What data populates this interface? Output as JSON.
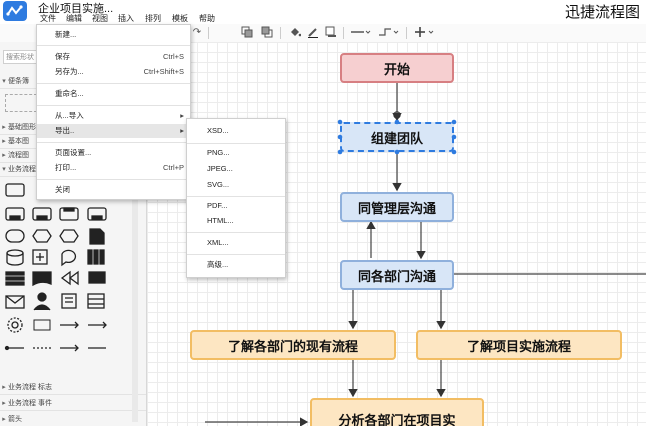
{
  "header": {
    "doc_title": "企业项目实施...",
    "brand": "迅捷流程图",
    "menus": [
      "文件",
      "编辑",
      "视图",
      "插入",
      "排列",
      "模板",
      "帮助"
    ]
  },
  "toolbar": {
    "icons": [
      "undo-icon",
      "redo-icon",
      "to-front-icon",
      "to-back-icon",
      "fill-color-icon",
      "line-color-icon",
      "shadow-icon",
      "line-style-icon",
      "waypoint-icon",
      "insert-icon"
    ]
  },
  "sidebar": {
    "search_placeholder": "搜索形状",
    "sections": [
      {
        "label": "便条簿",
        "expanded": true
      },
      {
        "label": "基础图形",
        "expanded": false
      },
      {
        "label": "基本图",
        "expanded": false
      },
      {
        "label": "流程图",
        "expanded": false
      },
      {
        "label": "业务流程",
        "expanded": true
      }
    ],
    "bottom_sections": [
      "业务流程 标志",
      "业务流程 事件",
      "箭头"
    ]
  },
  "file_menu": {
    "items": [
      {
        "label": "新建..."
      },
      {
        "label": "保存",
        "shortcut": "Ctrl+S"
      },
      {
        "label": "另存为...",
        "shortcut": "Ctrl+Shift+S"
      },
      {
        "label": "重命名..."
      },
      {
        "label": "从...导入",
        "submenu": true
      },
      {
        "label": "导出..",
        "submenu": true,
        "highlighted": true
      },
      {
        "label": "页面设置..."
      },
      {
        "label": "打印...",
        "shortcut": "Ctrl+P"
      },
      {
        "label": "关闭"
      }
    ]
  },
  "export_menu": {
    "items": [
      "XSD...",
      "PNG...",
      "JPEG...",
      "SVG...",
      "PDF...",
      "HTML...",
      "XML...",
      "高级..."
    ]
  },
  "diagram": {
    "nodes": [
      {
        "id": "start",
        "label": "开始",
        "style": "pink"
      },
      {
        "id": "team",
        "label": "组建团队",
        "style": "blue",
        "selected": true
      },
      {
        "id": "mgmt",
        "label": "同管理层沟通",
        "style": "blue"
      },
      {
        "id": "depts",
        "label": "同各部门沟通",
        "style": "blue"
      },
      {
        "id": "current",
        "label": "了解各部门的现有流程",
        "style": "orange"
      },
      {
        "id": "impl",
        "label": "了解项目实施流程",
        "style": "orange"
      },
      {
        "id": "analyze",
        "label": "分析各部门在项目实",
        "style": "orange"
      }
    ]
  },
  "colors": {
    "pink_fill": "#f6cfd0",
    "blue_fill": "#d8e6f7",
    "orange_fill": "#fde6c2",
    "selection": "#2e7be0"
  }
}
